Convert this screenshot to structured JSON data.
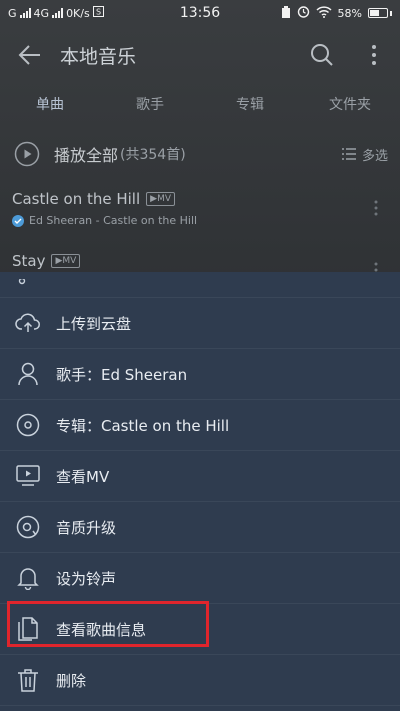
{
  "status_bar": {
    "carrier1": "G",
    "carrier2": "4G",
    "speed": "0K/s",
    "time": "13:56",
    "battery": "58%",
    "battery_level": 0.58
  },
  "app_bar": {
    "title": "本地音乐"
  },
  "tabs": [
    {
      "label": "单曲"
    },
    {
      "label": "歌手"
    },
    {
      "label": "专辑"
    },
    {
      "label": "文件夹"
    }
  ],
  "play_all": {
    "label": "播放全部",
    "count": "(共354首)",
    "multi_select": "多选"
  },
  "songs": [
    {
      "title": "Castle on the Hill",
      "badge": "MV",
      "subtitle": "Ed Sheeran - Castle on the Hill"
    },
    {
      "title": "Stay",
      "badge": "MV"
    }
  ],
  "sheet": {
    "items": [
      {
        "label": "上传到云盘",
        "icon": "cloud-upload-icon"
      },
      {
        "label": "歌手：Ed Sheeran",
        "icon": "person-icon"
      },
      {
        "label": "专辑：Castle on the Hill",
        "icon": "disc-icon"
      },
      {
        "label": "查看MV",
        "icon": "tv-icon"
      },
      {
        "label": "音质升级",
        "icon": "quality-disc-icon"
      },
      {
        "label": "设为铃声",
        "icon": "bell-icon"
      },
      {
        "label": "查看歌曲信息",
        "icon": "document-icon"
      },
      {
        "label": "删除",
        "icon": "trash-icon"
      }
    ]
  },
  "colors": {
    "sheet_bg": "#2f3c4f",
    "highlight": "#e0252c",
    "verified": "#4d9bd8"
  }
}
